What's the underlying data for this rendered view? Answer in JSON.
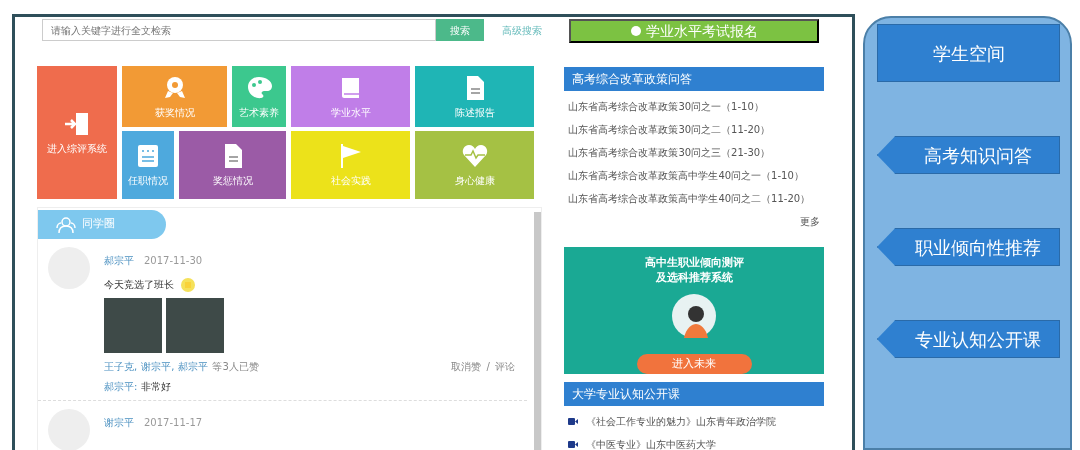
{
  "search": {
    "placeholder": "请输入关键字进行全文检索",
    "button": "搜索",
    "advanced": "高级搜索"
  },
  "exam_banner": {
    "label": "学业水平考试报名"
  },
  "tiles": [
    {
      "label": "进入综评系统",
      "kind": "door",
      "color": "#ef6c4d"
    },
    {
      "label": "获奖情况",
      "kind": "medal",
      "color": "#f29a35"
    },
    {
      "label": "艺术素养",
      "kind": "palette",
      "color": "#3cc88e"
    },
    {
      "label": "学业水平",
      "kind": "book",
      "color": "#c07ee8"
    },
    {
      "label": "陈述报告",
      "kind": "document",
      "color": "#1fb5b5"
    },
    {
      "label": "任职情况",
      "kind": "list",
      "color": "#4ea9dd"
    },
    {
      "label": "奖惩情况",
      "kind": "document",
      "color": "#9b5ba6"
    },
    {
      "label": "社会实践",
      "kind": "flag",
      "color": "#ece21a"
    },
    {
      "label": "身心健康",
      "kind": "heart",
      "color": "#a5c144"
    }
  ],
  "classmates": {
    "title": "同学圈",
    "posts": [
      {
        "author": "郝宗平",
        "date": "2017-11-30",
        "text": "今天竞选了班长",
        "photos": [
          {
            "kind": "photo"
          },
          {
            "kind": "photo"
          }
        ],
        "likers": [
          "王子克,",
          "谢宗平,",
          "郝宗平"
        ],
        "like_summary": "等3人已赞",
        "actions": [
          "取消赞",
          "评论"
        ],
        "action_separator": "/",
        "comments": [
          {
            "author": "郝宗平:",
            "text": "非常好"
          }
        ]
      },
      {
        "author": "谢宗平",
        "date": "2017-11-17"
      }
    ]
  },
  "policy": {
    "title": "高考综合改革政策问答",
    "links": [
      "山东省高考综合改革政策30问之一（1-10）",
      "山东省高考综合改革政策30问之二（11-20）",
      "山东省高考综合改革政策30问之三（21-30）",
      "山东省高考综合改革政策高中学生40问之一（1-10）",
      "山东省高考综合改革政策高中学生40问之二（11-20）"
    ],
    "more": "更多"
  },
  "promo": {
    "title_lines": [
      "高中生职业倾向测评",
      "及选科推荐系统"
    ],
    "button": "进入未来"
  },
  "courses": {
    "title": "大学专业认知公开课",
    "links": [
      "《社会工作专业的魅力》山东青年政治学院",
      "《中医专业》山东中医药大学"
    ]
  },
  "callouts": [
    {
      "kind": "title",
      "label": "学生空间"
    },
    {
      "kind": "arrow",
      "label": "高考知识问答"
    },
    {
      "kind": "arrow",
      "label": "职业倾向性推荐"
    },
    {
      "kind": "arrow",
      "label": "专业认知公开课"
    }
  ]
}
